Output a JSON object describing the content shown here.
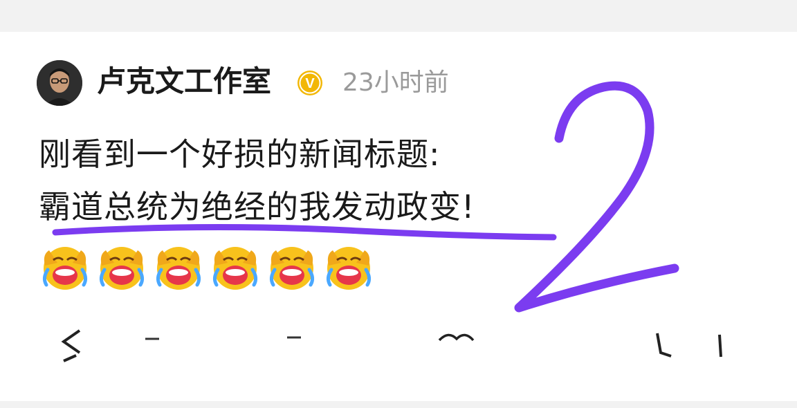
{
  "post": {
    "author": "卢克文工作室",
    "verified_badge": "V",
    "timestamp": "23小时前",
    "text_line1": "刚看到一个好损的新闻标题:",
    "text_line2": "霸道总统为绝经的我发动政变!",
    "emoji_count": 6,
    "emoji_icon": "laughing-crying-face-icon"
  },
  "annotation": {
    "handwritten_number": "2",
    "color": "#7b3cf0"
  },
  "colors": {
    "badge": "#f2b705",
    "time": "#9a9a9a",
    "text": "#1a1a1a"
  }
}
